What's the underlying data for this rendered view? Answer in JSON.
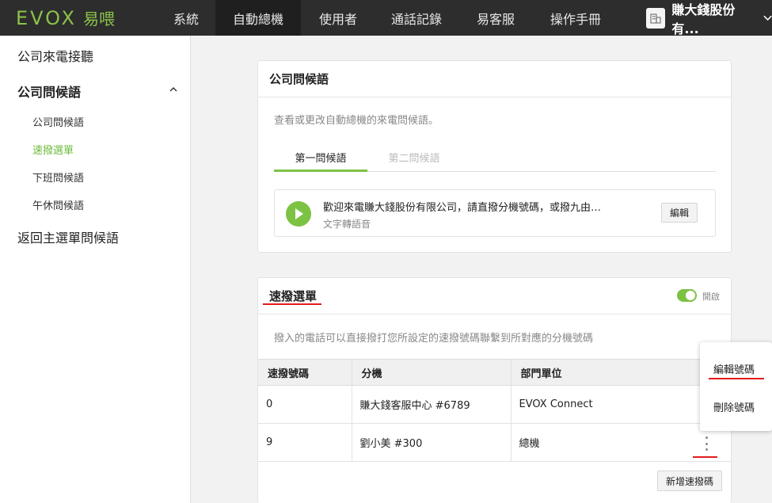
{
  "logo": {
    "main": "EVOX",
    "sub": "易喂"
  },
  "nav": [
    "系統",
    "自動總機",
    "使用者",
    "通話記錄",
    "易客服",
    "操作手冊"
  ],
  "company_name": "賺大錢股份有...",
  "sidebar": {
    "item1": "公司來電接聽",
    "item2": "公司問候語",
    "subs": [
      "公司問候語",
      "速撥選單",
      "下班問候語",
      "午休問候語"
    ],
    "item3": "返回主選單問候語"
  },
  "greeting_card": {
    "title": "公司問候語",
    "description": "查看或更改自動總機的來電問候語。",
    "tabs": [
      "第一問候語",
      "第二問候語"
    ],
    "message": "歡迎來電賺大錢股份有限公司，請直撥分機號碼，或撥九由…",
    "message_type": "文字轉語音",
    "edit_label": "編輯"
  },
  "speed_dial_card": {
    "title": "速撥選單",
    "toggle_label": "開啟",
    "toggle_on": true,
    "description": "撥入的電話可以直接撥打您所設定的速撥號碼聯繫到所對應的分機號碼",
    "columns": [
      "速撥號碼",
      "分機",
      "部門單位"
    ],
    "rows": [
      [
        "0",
        "賺大錢客服中心 #6789",
        "EVOX Connect"
      ],
      [
        "9",
        "劉小美 #300",
        "總機"
      ]
    ],
    "add_label": "新增速撥碼"
  },
  "context_menu": {
    "edit": "編輯號碼",
    "delete": "刪除號碼"
  },
  "colors": {
    "accent": "#7cc243",
    "topbar": "#2d2d2d",
    "annotation": "#e31b1b"
  }
}
